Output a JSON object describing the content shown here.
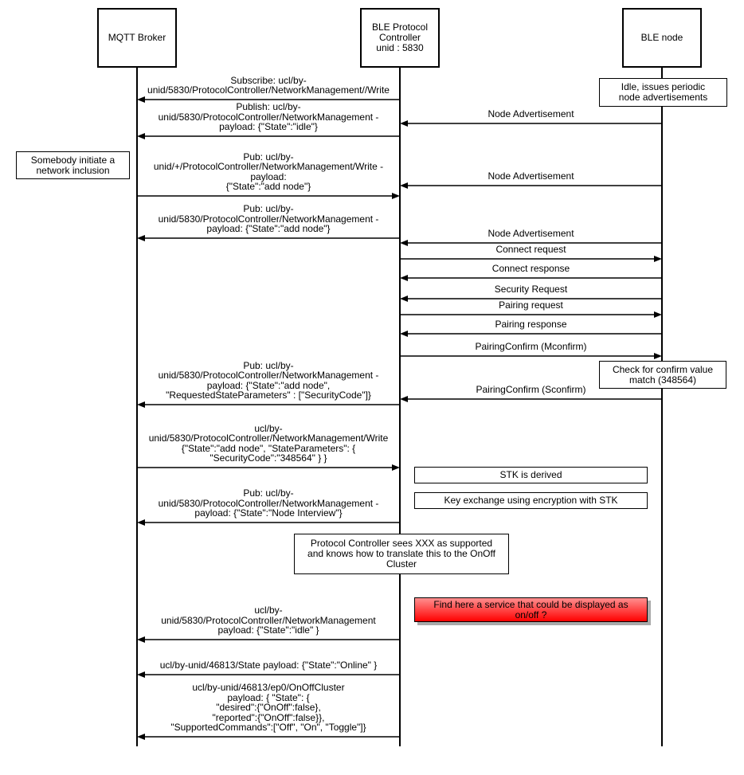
{
  "actors": [
    {
      "id": "mqtt",
      "label": "MQTT Broker"
    },
    {
      "id": "pc",
      "label": "BLE Protocol\nController\nunid : 5830"
    },
    {
      "id": "node",
      "label": "BLE node"
    }
  ],
  "messages": [
    {
      "from": "pc",
      "to": "mqtt",
      "label": "Subscribe: ucl/by-\nunid/5830/ProtocolController/NetworkManagement//Write"
    },
    {
      "from": "pc",
      "to": "mqtt",
      "label": "Publish: ucl/by-\nunid/5830/ProtocolController/NetworkManagement -\npayload: {\"State\":\"idle\"}"
    },
    {
      "from": "node",
      "to": "pc",
      "label": "Node Advertisement"
    },
    {
      "from": "mqtt",
      "to": "pc",
      "label": "Pub: ucl/by-\nunid/+/ProtocolController/NetworkManagement/Write -\npayload:\n{\"State\":\"add node\"}"
    },
    {
      "from": "node",
      "to": "pc",
      "label": "Node Advertisement"
    },
    {
      "from": "pc",
      "to": "mqtt",
      "label": "Pub: ucl/by-\nunid/5830/ProtocolController/NetworkManagement -\npayload: {\"State\":\"add node\"}"
    },
    {
      "from": "node",
      "to": "pc",
      "label": "Node Advertisement"
    },
    {
      "from": "pc",
      "to": "node",
      "label": "Connect request"
    },
    {
      "from": "node",
      "to": "pc",
      "label": "Connect response"
    },
    {
      "from": "node",
      "to": "pc",
      "label": "Security Request"
    },
    {
      "from": "pc",
      "to": "node",
      "label": "Pairing request"
    },
    {
      "from": "node",
      "to": "pc",
      "label": "Pairing response"
    },
    {
      "from": "pc",
      "to": "node",
      "label": "PairingConfirm (Mconfirm)"
    },
    {
      "from": "node",
      "to": "pc",
      "label": "PairingConfirm (Sconfirm)"
    },
    {
      "from": "pc",
      "to": "mqtt",
      "label": "Pub: ucl/by-\nunid/5830/ProtocolController/NetworkManagement -\npayload: {\"State\":\"add node\",\n\"RequestedStateParameters\" : [\"SecurityCode\"]}"
    },
    {
      "from": "mqtt",
      "to": "pc",
      "label": "ucl/by-\nunid/5830/ProtocolController/NetworkManagement/Write\n{\"State\":\"add node\", \"StateParameters\": {\n\"SecurityCode\":\"348564\" } }"
    },
    {
      "from": "pc",
      "to": "mqtt",
      "label": "Pub: ucl/by-\nunid/5830/ProtocolController/NetworkManagement -\npayload: {\"State\":\"Node Interview\"}"
    },
    {
      "from": "pc",
      "to": "mqtt",
      "label": "ucl/by-\nunid/5830/ProtocolController/NetworkManagement\npayload: {\"State\":\"idle\" }"
    },
    {
      "from": "pc",
      "to": "mqtt",
      "label": "ucl/by-unid/46813/State payload: {\"State\":\"Online\" }"
    },
    {
      "from": "pc",
      "to": "mqtt",
      "label": "ucl/by-unid/46813/ep0/OnOffCluster\npayload:  { \"State\": {\n\"desired\":{\"OnOff\":false},\n\"reported\":{\"OnOff\":false}},\n\"SupportedCommands\":[\"Off\", \"On\", \"Toggle\"]}"
    }
  ],
  "notes": [
    {
      "label": "Idle, issues periodic\nnode advertisements"
    },
    {
      "label": "Somebody initiate a\nnetwork inclusion"
    },
    {
      "label": "Check for confirm value\nmatch (348564)"
    },
    {
      "label": "STK is derived"
    },
    {
      "label": "Key exchange using encryption with STK"
    },
    {
      "label": "Protocol Controller sees XXX as supported\nand knows how to translate this to the OnOff\nCluster"
    },
    {
      "label": "Find here a service that could be displayed as\non/off ?",
      "highlight": true
    }
  ],
  "colors": {
    "highlight": "#ff0000",
    "line": "#000000"
  }
}
